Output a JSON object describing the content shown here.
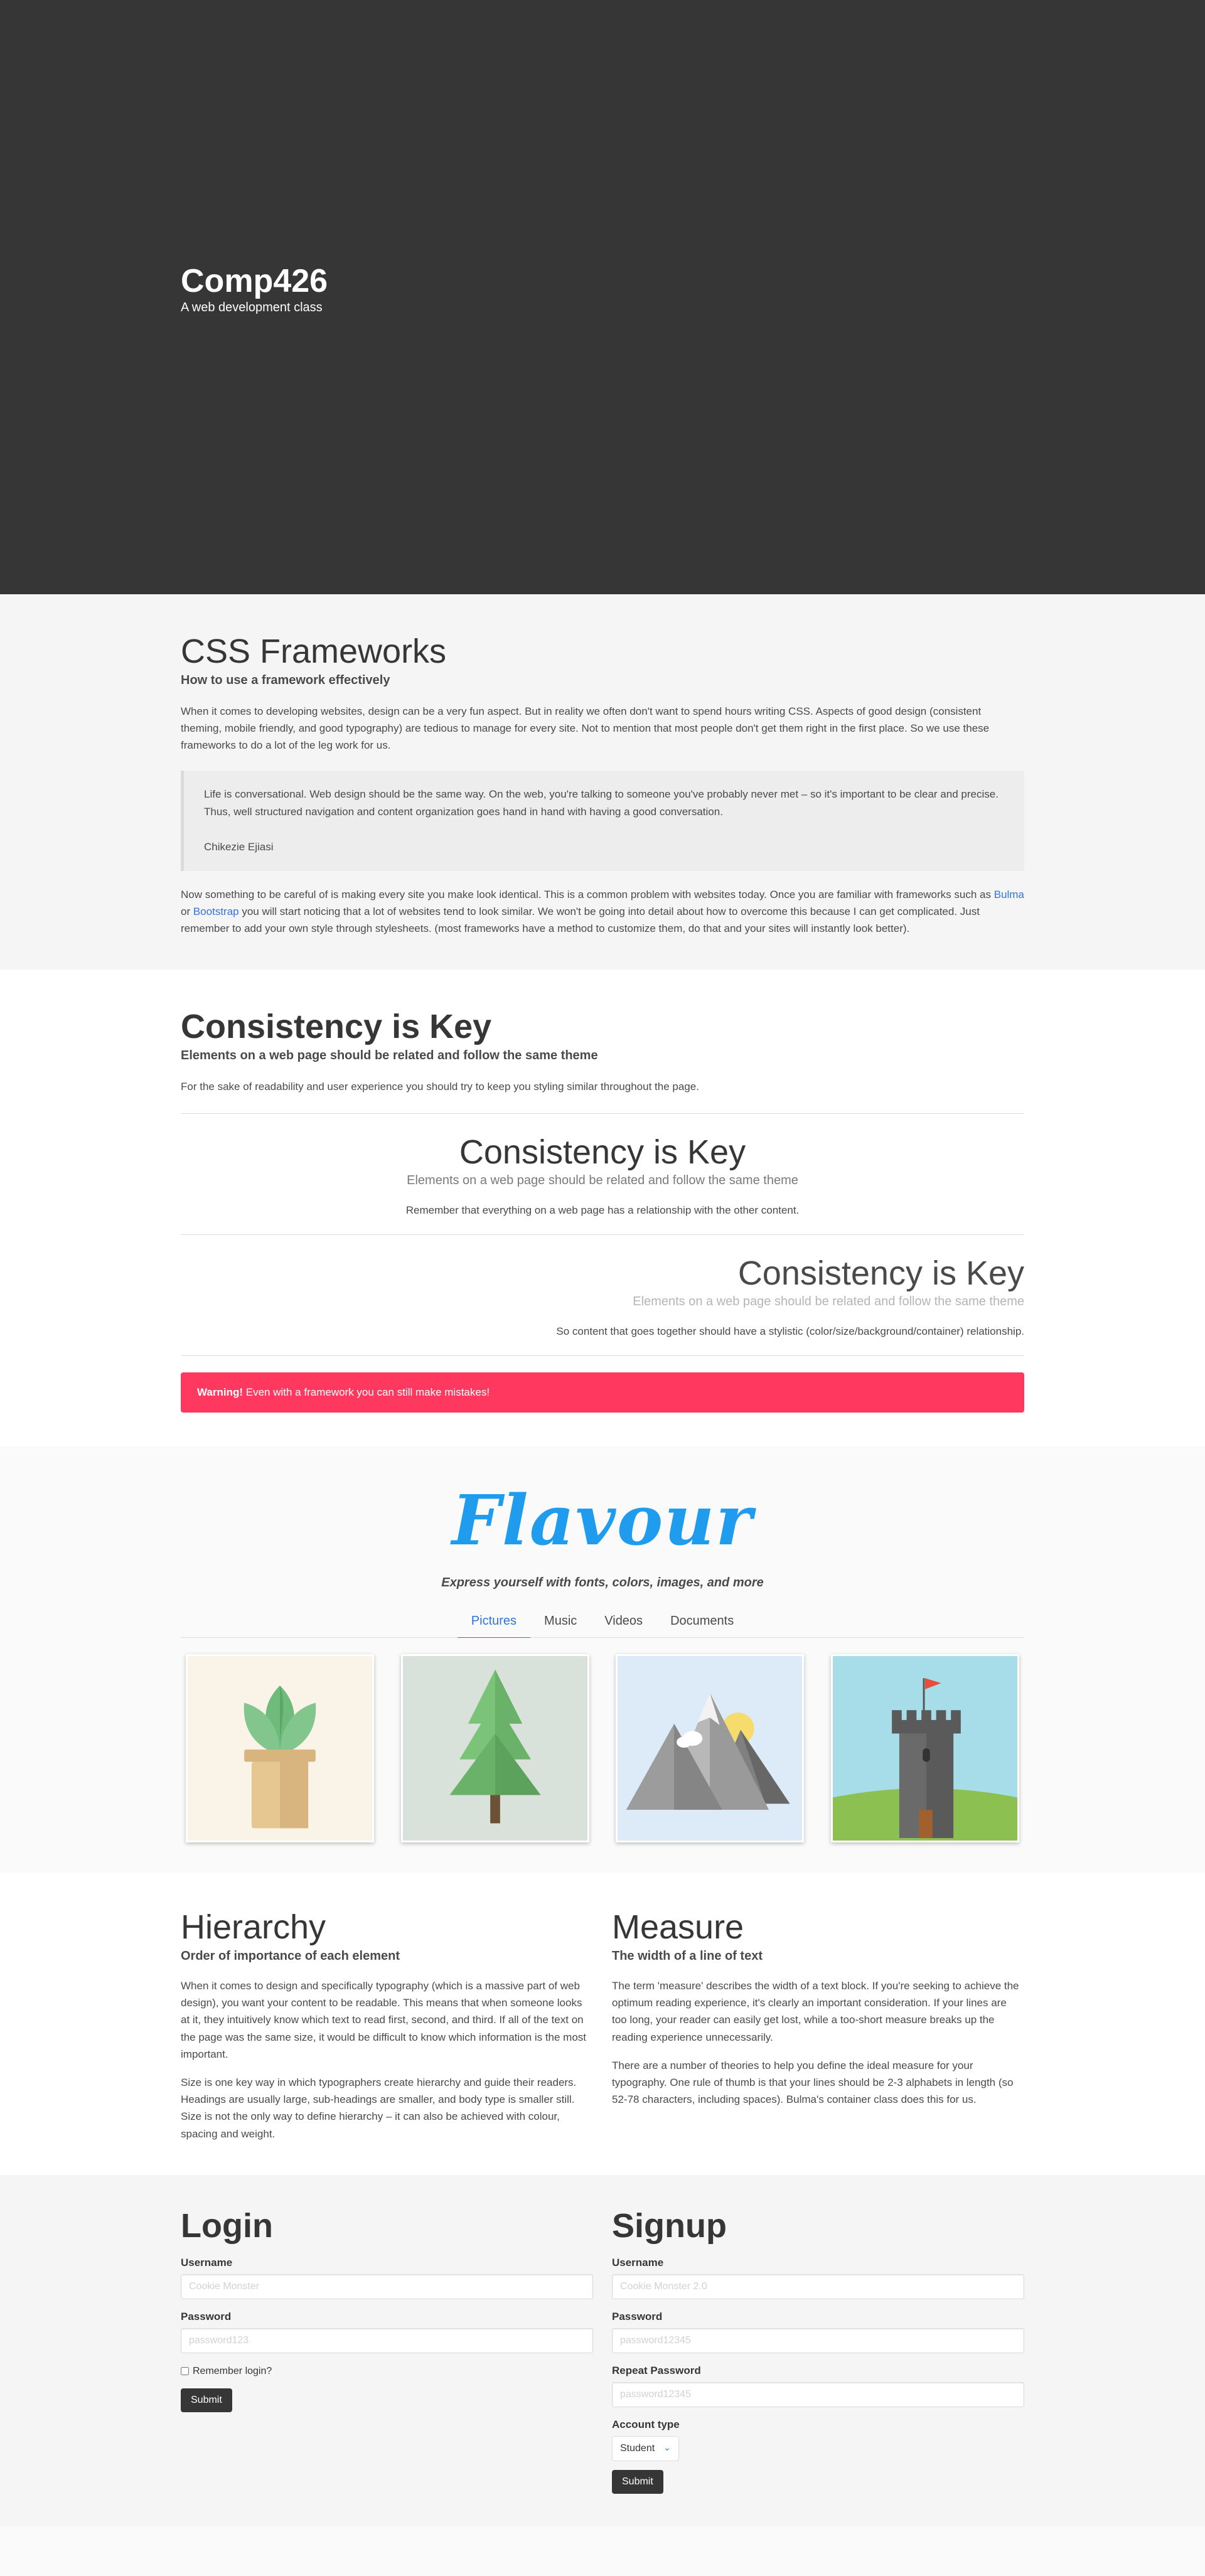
{
  "hero": {
    "title": "Comp426",
    "subtitle": "A web development class"
  },
  "frameworks": {
    "title": "CSS Frameworks",
    "subtitle": "How to use a framework effectively",
    "intro": "When it comes to developing websites, design can be a very fun aspect. But in reality we often don't want to spend hours writing CSS. Aspects of good design (consistent theming, mobile friendly, and good typography) are tedious to manage for every site. Not to mention that most people don't get them right in the first place. So we use these frameworks to do a lot of the leg work for us.",
    "quote": "Life is conversational. Web design should be the same way. On the web, you're talking to someone you've probably never met – so it's important to be clear and precise. Thus, well structured navigation and content organization goes hand in hand with having a good conversation.",
    "quote_author": "Chikezie Ejiasi",
    "outro_before": "Now something to be careful of is making every site you make look identical. This is a common problem with websites today. Once you are familiar with frameworks such as ",
    "link_bulma": "Bulma",
    "outro_or": " or ",
    "link_bootstrap": "Bootstrap",
    "outro_after": " you will start noticing that a lot of websites tend to look similar. We won't be going into detail about how to overcome this because I can get complicated. Just remember to add your own style through stylesheets. (most frameworks have a method to customize them, do that and your sites will instantly look better)."
  },
  "consistency": {
    "title": "Consistency is Key",
    "subtitle": "Elements on a web page should be related and follow the same theme",
    "intro": "For the sake of readability and user experience you should try to keep you styling similar throughout the page.",
    "center": {
      "title": "Consistency is Key",
      "subtitle": "Elements on a web page should be related and follow the same theme",
      "text": "Remember that everything on a web page has a relationship with the other content."
    },
    "right": {
      "title": "Consistency is Key",
      "subtitle": "Elements on a web page should be related and follow the same theme",
      "text": "So content that goes together should have a stylistic (color/size/background/container) relationship."
    },
    "warning_strong": "Warning!",
    "warning_text": " Even with a framework you can still make mistakes!"
  },
  "flavour": {
    "title": "Flavour",
    "subtitle": "Express yourself with fonts, colors, images, and more",
    "tabs": [
      "Pictures",
      "Music",
      "Videos",
      "Documents"
    ],
    "active_tab": "Pictures",
    "cards": [
      "plant-illustration",
      "tree-illustration",
      "mountains-illustration",
      "castle-tower-illustration"
    ]
  },
  "hierarchy": {
    "title": "Hierarchy",
    "subtitle": "Order of importance of each element",
    "p1": "When it comes to design and specifically typography (which is a massive part of web design), you want your content to be readable. This means that when someone looks at it, they intuitively know which text to read first, second, and third. If all of the text on the page was the same size, it would be difficult to know which information is the most important.",
    "p2": "Size is one key way in which typographers create hierarchy and guide their readers. Headings are usually large, sub-headings are smaller, and body type is smaller still. Size is not the only way to define hierarchy – it can also be achieved with colour, spacing and weight."
  },
  "measure": {
    "title": "Measure",
    "subtitle": "The width of a line of text",
    "p1": "The term 'measure' describes the width of a text block. If you're seeking to achieve the optimum reading experience, it's clearly an important consideration. If your lines are too long, your reader can easily get lost, while a too-short measure breaks up the reading experience unnecessarily.",
    "p2": "There are a number of theories to help you define the ideal measure for your typography. One rule of thumb is that your lines should be 2-3 alphabets in length (so 52-78 characters, including spaces). Bulma's container class does this for us."
  },
  "login": {
    "title": "Login",
    "username_label": "Username",
    "username_placeholder": "Cookie Monster",
    "password_label": "Password",
    "password_placeholder": "password123",
    "remember_label": "Remember login?",
    "submit": "Submit"
  },
  "signup": {
    "title": "Signup",
    "username_label": "Username",
    "username_placeholder": "Cookie Monster 2.0",
    "password_label": "Password",
    "password_placeholder": "password12345",
    "repeat_label": "Repeat Password",
    "repeat_placeholder": "password12345",
    "account_label": "Account type",
    "account_value": "Student",
    "submit": "Submit"
  },
  "colors": {
    "hero_bg": "#363636",
    "link": "#3273dc",
    "warning": "#ff3860",
    "flavour": "#209cee"
  }
}
